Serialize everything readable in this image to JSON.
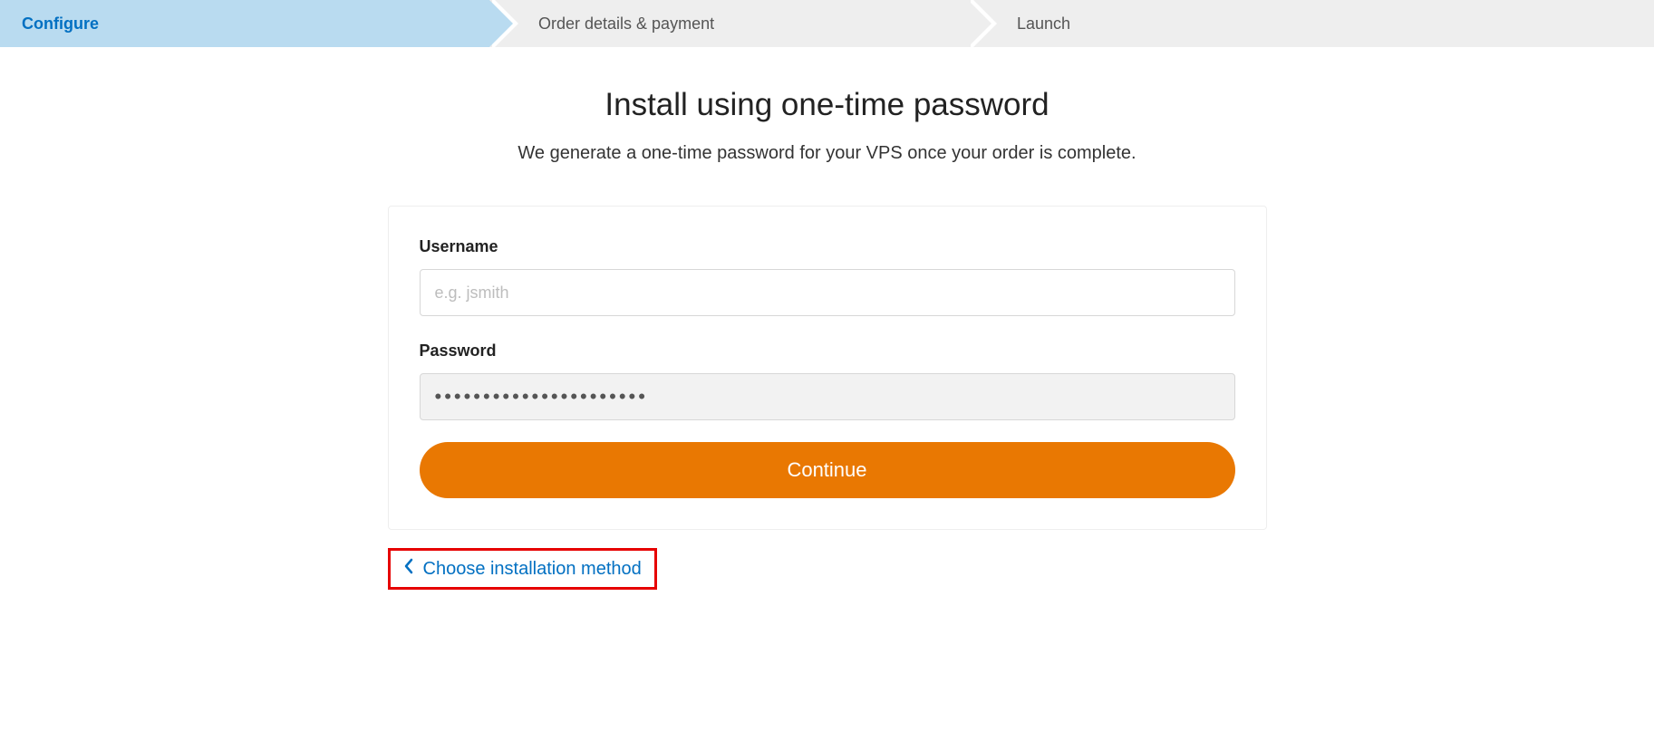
{
  "stepper": {
    "steps": [
      {
        "label": "Configure"
      },
      {
        "label": "Order details & payment"
      },
      {
        "label": "Launch"
      }
    ]
  },
  "page": {
    "title": "Install using one-time password",
    "subtitle": "We generate a one-time password for your VPS once your order is complete."
  },
  "form": {
    "username_label": "Username",
    "username_placeholder": "e.g. jsmith",
    "username_value": "",
    "password_label": "Password",
    "password_value": "••••••••••••••••••••••",
    "continue_label": "Continue"
  },
  "back_link": {
    "label": "Choose installation method"
  }
}
